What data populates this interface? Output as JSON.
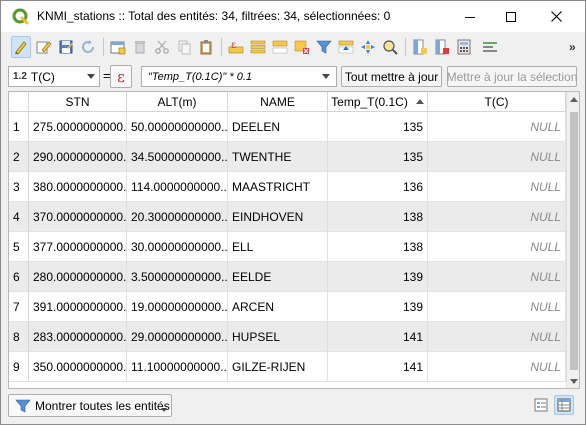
{
  "window": {
    "title": "KNMI_stations :: Total des entités: 34, filtrées: 34, sélectionnées: 0",
    "icon": "qgis-logo-icon",
    "accent": "#589632"
  },
  "calc_bar": {
    "field_type": "1.2",
    "field_name": "T(C)",
    "equals": "=",
    "epsilon": "ε",
    "expression": "\"Temp_T(0.1C)\" * 0.1",
    "update_all": "Tout mettre à jour",
    "update_selected": "Mettre à jour la sélection"
  },
  "table": {
    "columns": [
      "STN",
      "ALT(m)",
      "NAME",
      "Temp_T(0.1C)",
      "T(C)"
    ],
    "sorted_column": "Temp_T(0.1C)",
    "sort_direction": "ascending",
    "rows": [
      {
        "n": "1",
        "stn": "275.0000000000...",
        "alt": "50.00000000000...",
        "name": "DEELEN",
        "temp": "135",
        "tc": "NULL"
      },
      {
        "n": "2",
        "stn": "290.0000000000...",
        "alt": "34.50000000000...",
        "name": "TWENTHE",
        "temp": "135",
        "tc": "NULL"
      },
      {
        "n": "3",
        "stn": "380.0000000000...",
        "alt": "114.0000000000...",
        "name": "MAASTRICHT",
        "temp": "136",
        "tc": "NULL"
      },
      {
        "n": "4",
        "stn": "370.0000000000...",
        "alt": "20.30000000000...",
        "name": "EINDHOVEN",
        "temp": "138",
        "tc": "NULL"
      },
      {
        "n": "5",
        "stn": "377.0000000000...",
        "alt": "30.00000000000...",
        "name": "ELL",
        "temp": "138",
        "tc": "NULL"
      },
      {
        "n": "6",
        "stn": "280.0000000000...",
        "alt": "3.500000000000...",
        "name": "EELDE",
        "temp": "139",
        "tc": "NULL"
      },
      {
        "n": "7",
        "stn": "391.0000000000...",
        "alt": "19.00000000000...",
        "name": "ARCEN",
        "temp": "139",
        "tc": "NULL"
      },
      {
        "n": "8",
        "stn": "283.0000000000...",
        "alt": "29.00000000000...",
        "name": "HUPSEL",
        "temp": "141",
        "tc": "NULL"
      },
      {
        "n": "9",
        "stn": "350.0000000000...",
        "alt": "11.10000000000...",
        "name": "GILZE-RIJEN",
        "temp": "141",
        "tc": "NULL"
      }
    ]
  },
  "bottom": {
    "filter_label": "Montrer toutes les entités"
  },
  "toolbar_icons": [
    "toggle-editing-icon",
    "multi-edit-icon",
    "save-edits-icon",
    "reload-icon",
    "add-feature-icon",
    "delete-feature-icon",
    "cut-icon",
    "copy-icon",
    "paste-icon",
    "select-by-expression-icon",
    "select-all-icon",
    "invert-selection-icon",
    "deselect-all-icon",
    "filter-select-icon",
    "move-selection-top-icon",
    "pan-to-selection-icon",
    "zoom-to-selection-icon",
    "new-field-icon",
    "delete-field-icon",
    "field-calculator-icon",
    "conditional-formatting-icon",
    "more-tools-icon"
  ]
}
